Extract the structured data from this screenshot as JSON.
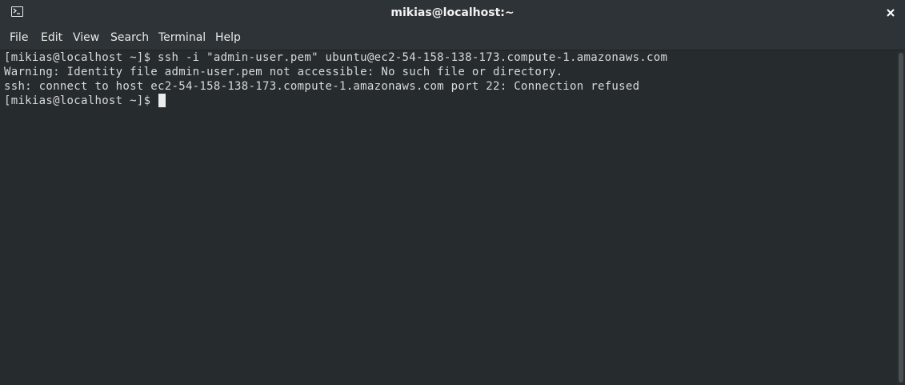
{
  "window": {
    "title": "mikias@localhost:~",
    "icon": "terminal-icon",
    "close_icon": "close-icon"
  },
  "menubar": {
    "items": [
      {
        "label": "File"
      },
      {
        "label": "Edit"
      },
      {
        "label": "View"
      },
      {
        "label": "Search"
      },
      {
        "label": "Terminal"
      },
      {
        "label": "Help"
      }
    ]
  },
  "terminal": {
    "lines": [
      "[mikias@localhost ~]$ ssh -i \"admin-user.pem\" ubuntu@ec2-54-158-138-173.compute-1.amazonaws.com",
      "Warning: Identity file admin-user.pem not accessible: No such file or directory.",
      "ssh: connect to host ec2-54-158-138-173.compute-1.amazonaws.com port 22: Connection refused"
    ],
    "prompt": "[mikias@localhost ~]$ "
  },
  "colors": {
    "titlebar_bg": "#2e3337",
    "terminal_bg": "#262b2e",
    "terminal_fg": "#d9d9d9",
    "cursor": "#ececec"
  }
}
